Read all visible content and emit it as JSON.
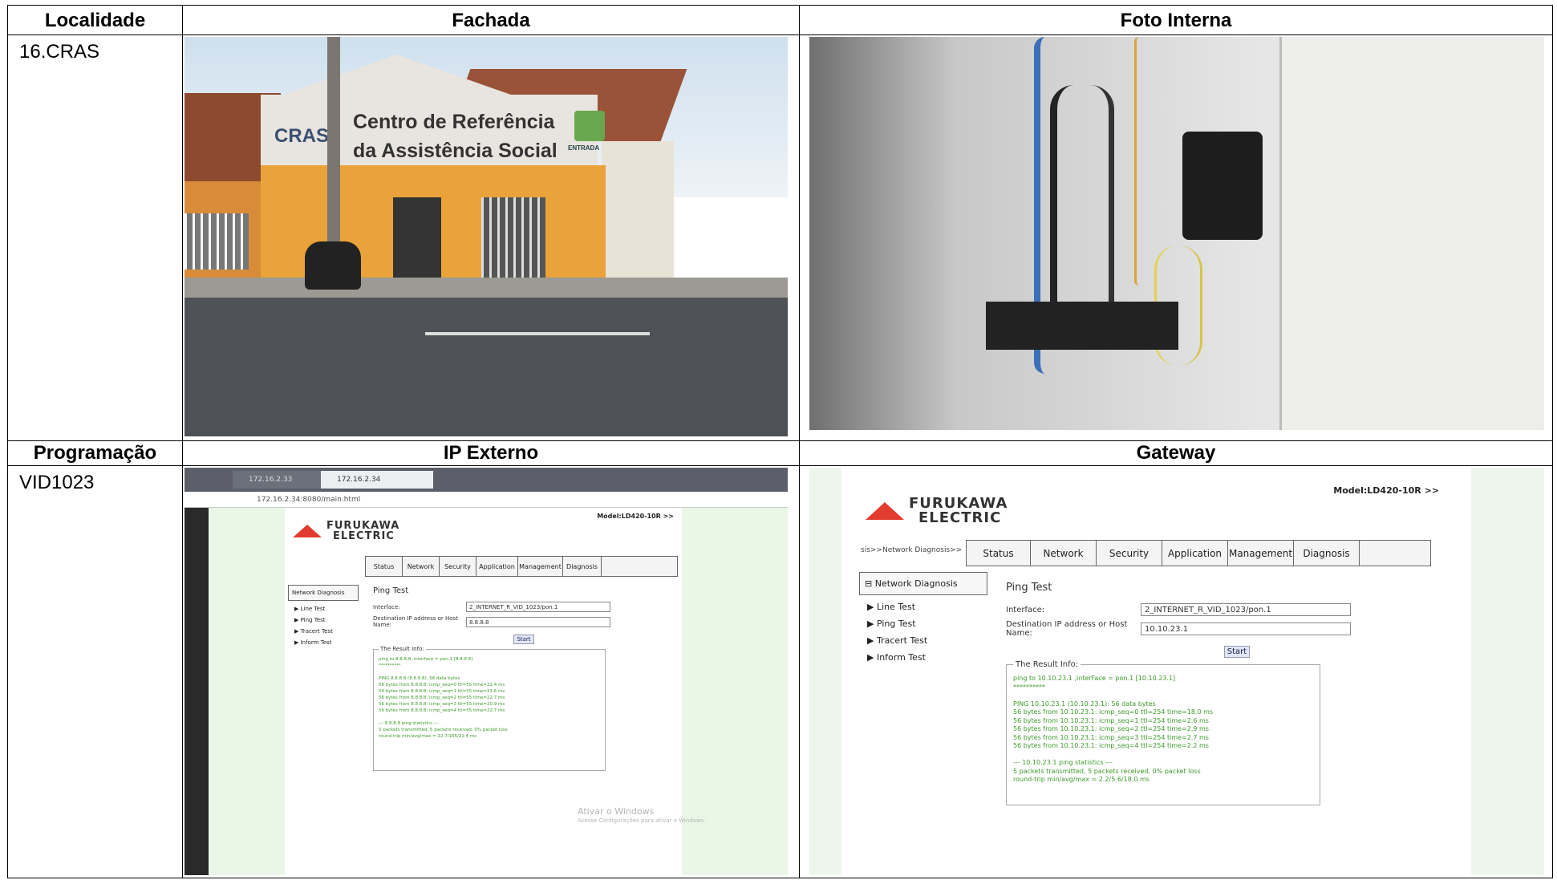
{
  "headers": {
    "localidade": "Localidade",
    "fachada": "Fachada",
    "foto_interna": "Foto Interna",
    "programacao": "Programação",
    "ip_externo": "IP Externo",
    "gateway": "Gateway"
  },
  "values": {
    "localidade": "16.CRAS",
    "programacao": "VID1023"
  },
  "fachada_sign": {
    "line1": "Centro de Referência",
    "line2": "da Assistência Social",
    "logo": "CRAS",
    "entrada": "ENTRADA"
  },
  "ip_externo_shot": {
    "tab1": "172.16.2.33",
    "tab2": "172.16.2.34",
    "address": "172.16.2.34:8080/main.html",
    "brand_line1": "FURUKAWA",
    "brand_line2": "ELECTRIC",
    "model": "Model:LD420-10R >>",
    "menu": [
      "Status",
      "Network",
      "Security",
      "Application",
      "Management",
      "Diagnosis"
    ],
    "side_head": "Network Diagnosis",
    "side_items": [
      "Line Test",
      "Ping Test",
      "Tracert Test",
      "Inform Test"
    ],
    "title": "Ping Test",
    "interface_label": "Interface:",
    "interface_value": "2_INTERNET_R_VID_1023/pon.1",
    "dest_label": "Destination IP address or Host Name:",
    "dest_value": "8.8.8.8",
    "start": "Start",
    "result_title": "The Result Info:",
    "result_lines": [
      "ping to 8.8.8.8 ,interface = pon.1 [8.8.8.8]",
      "**********",
      "",
      "PING 8.8.8.8 (8.8.8.8): 56 data bytes",
      "56 bytes from 8.8.8.8: icmp_seq=0 ttl=55 time=21.4 ms",
      "56 bytes from 8.8.8.8: icmp_seq=1 ttl=55 time=21.6 ms",
      "56 bytes from 8.8.8.8: icmp_seq=2 ttl=55 time=22.7 ms",
      "56 bytes from 8.8.8.8: icmp_seq=3 ttl=55 time=20.9 ms",
      "56 bytes from 8.8.8.8: icmp_seq=4 ttl=55 time=22.7 ms",
      "",
      "--- 8.8.8.8 ping statistics ---",
      "5 packets transmitted, 5 packets received, 0% packet loss",
      "round-trip min/avg/max = 22.7/165/21.4 ms"
    ],
    "watermark1": "Ativar o Windows",
    "watermark2": "Acesse Configurações para ativar o Windows."
  },
  "gateway_shot": {
    "brand_line1": "FURUKAWA",
    "brand_line2": "ELECTRIC",
    "model": "Model:LD420-10R >>",
    "breadcrumb": "sis>>Network Diagnosis>>",
    "menu": [
      "Status",
      "Network",
      "Security",
      "Application",
      "Management",
      "Diagnosis"
    ],
    "side_head": "Network Diagnosis",
    "side_items": [
      "Line Test",
      "Ping Test",
      "Tracert Test",
      "Inform Test"
    ],
    "title": "Ping Test",
    "interface_label": "Interface:",
    "interface_value": "2_INTERNET_R_VID_1023/pon.1",
    "dest_label": "Destination IP address or Host Name:",
    "dest_value": "10.10.23.1",
    "start": "Start",
    "result_title": "The Result Info:",
    "result_lines": [
      "ping to 10.10.23.1 ,interFace = pon.1 [10.10.23.1]",
      "**********",
      "",
      "PING 10.10.23.1 (10.10.23.1): 56 data bytes",
      "56 bytes from 10.10.23.1: icmp_seq=0 ttl=254 time=18.0 ms",
      "56 bytes from 10.10.23.1: icmp_seq=1 ttl=254 time=2.6 ms",
      "56 bytes from 10.10.23.1: icmp_seq=2 ttl=254 time=2.9 ms",
      "56 bytes from 10.10.23.1: icmp_seq=3 ttl=254 time=2.7 ms",
      "56 bytes from 10.10.23.1: icmp_seq=4 ttl=254 time=2.2 ms",
      "",
      "--- 10.10.23.1 ping statistics ---",
      "5 packets transmitted, 5 packets received, 0% packet loss",
      "round-trip min/avg/max = 2.2/5.6/18.0 ms"
    ]
  }
}
